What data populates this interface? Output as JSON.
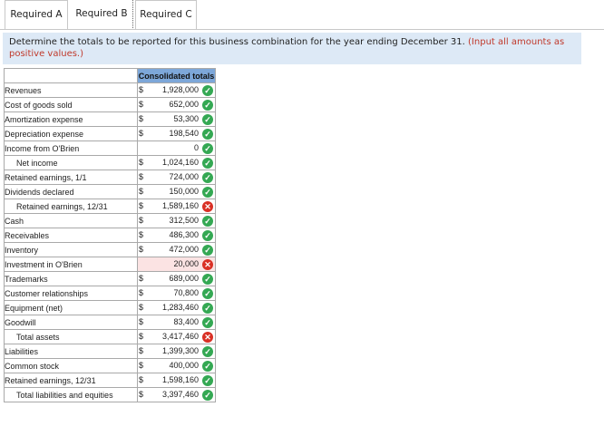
{
  "tabs": [
    {
      "label": "Required A"
    },
    {
      "label": "Required B"
    },
    {
      "label": "Required C"
    }
  ],
  "instruction": {
    "text": "Determine the totals to be reported for this business combination for the year ending December 31.",
    "note": "(Input all amounts as positive values.)"
  },
  "table": {
    "header": "Consolidated totals",
    "rows": [
      {
        "label": "Revenues",
        "dollar": "$",
        "value": "1,928,000",
        "status": "correct"
      },
      {
        "label": "Cost of goods sold",
        "dollar": "$",
        "value": "652,000",
        "status": "correct"
      },
      {
        "label": "Amortization expense",
        "dollar": "$",
        "value": "53,300",
        "status": "correct"
      },
      {
        "label": "Depreciation expense",
        "dollar": "$",
        "value": "198,540",
        "status": "correct"
      },
      {
        "label": "Income from O'Brien",
        "dollar": "",
        "value": "0",
        "status": "correct"
      },
      {
        "label": "Net income",
        "dollar": "$",
        "value": "1,024,160",
        "status": "correct",
        "indent": true
      },
      {
        "label": "Retained earnings, 1/1",
        "dollar": "$",
        "value": "724,000",
        "status": "correct"
      },
      {
        "label": "Dividends declared",
        "dollar": "$",
        "value": "150,000",
        "status": "correct"
      },
      {
        "label": "Retained earnings, 12/31",
        "dollar": "$",
        "value": "1,589,160",
        "status": "incorrect",
        "indent": true
      },
      {
        "label": "Cash",
        "dollar": "$",
        "value": "312,500",
        "status": "correct"
      },
      {
        "label": "Receivables",
        "dollar": "$",
        "value": "486,300",
        "status": "correct"
      },
      {
        "label": "Inventory",
        "dollar": "$",
        "value": "472,000",
        "status": "correct"
      },
      {
        "label": "Investment in O'Brien",
        "dollar": "",
        "value": "20,000",
        "status": "incorrect"
      },
      {
        "label": "Trademarks",
        "dollar": "$",
        "value": "689,000",
        "status": "correct"
      },
      {
        "label": "Customer relationships",
        "dollar": "$",
        "value": "70,800",
        "status": "correct"
      },
      {
        "label": "Equipment (net)",
        "dollar": "$",
        "value": "1,283,460",
        "status": "correct"
      },
      {
        "label": "Goodwill",
        "dollar": "$",
        "value": "83,400",
        "status": "correct"
      },
      {
        "label": "Total assets",
        "dollar": "$",
        "value": "3,417,460",
        "status": "incorrect",
        "indent": true
      },
      {
        "label": "Liabilities",
        "dollar": "$",
        "value": "1,399,300",
        "status": "correct"
      },
      {
        "label": "Common stock",
        "dollar": "$",
        "value": "400,000",
        "status": "correct"
      },
      {
        "label": "Retained earnings, 12/31",
        "dollar": "$",
        "value": "1,598,160",
        "status": "correct"
      },
      {
        "label": "Total liabilities and equities",
        "dollar": "$",
        "value": "3,397,460",
        "status": "correct",
        "indent": true
      }
    ]
  },
  "icons": {
    "correct": "check-circle-icon",
    "incorrect": "x-circle-icon"
  },
  "colors": {
    "header_bg": "#7da7d9",
    "instruction_bg": "#dde9f6",
    "correct": "#34a853",
    "incorrect": "#d93025",
    "invalid_cell": "#fbe3e3"
  }
}
